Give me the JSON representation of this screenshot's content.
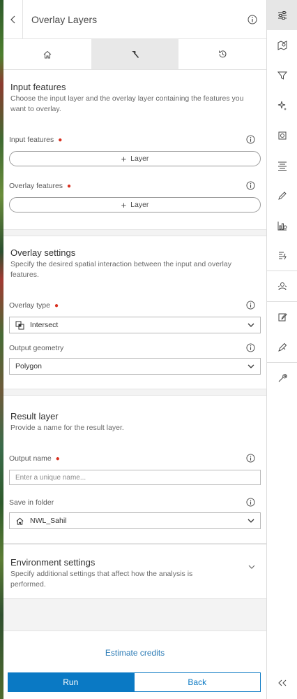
{
  "header": {
    "title": "Overlay Layers"
  },
  "tabs": [
    {
      "name": "home"
    },
    {
      "name": "tool"
    },
    {
      "name": "history"
    }
  ],
  "input_section": {
    "title": "Input features",
    "description": "Choose the input layer and the overlay layer containing the features you want to overlay.",
    "input_label": "Input features",
    "input_button": "Layer",
    "overlay_label": "Overlay features",
    "overlay_button": "Layer"
  },
  "overlay_section": {
    "title": "Overlay settings",
    "description": "Specify the desired spatial interaction between the input and overlay features.",
    "type_label": "Overlay type",
    "type_value": "Intersect",
    "geometry_label": "Output geometry",
    "geometry_value": "Polygon"
  },
  "result_section": {
    "title": "Result layer",
    "description": "Provide a name for the result layer.",
    "name_label": "Output name",
    "name_placeholder": "Enter a unique name...",
    "folder_label": "Save in folder",
    "folder_value": "NWL_Sahil"
  },
  "env_section": {
    "title": "Environment settings",
    "description": "Specify additional settings that affect how the analysis is performed."
  },
  "footer": {
    "estimate": "Estimate credits",
    "run": "Run",
    "back": "Back"
  },
  "colors": {
    "accent": "#0a79c4",
    "required": "#d83020"
  }
}
